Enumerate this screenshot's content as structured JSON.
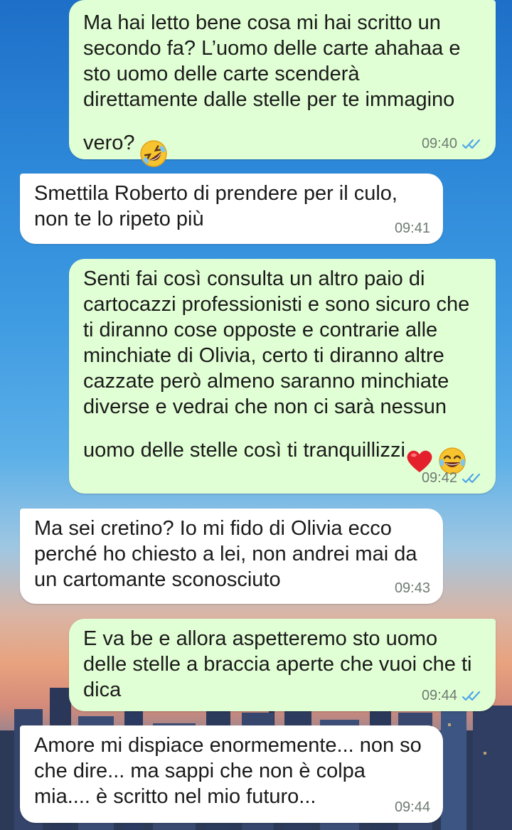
{
  "messages": [
    {
      "direction": "outgoing",
      "text": "Ma hai letto bene cosa mi hai scritto un secondo fa? L’uomo delle carte ahahaa e sto uomo delle carte scenderà direttamente dalle stelle per te immagino vero?",
      "emoji": [
        "rolling-on-floor-laughing"
      ],
      "time": "09:40",
      "status": "read"
    },
    {
      "direction": "incoming",
      "text": "Smettila Roberto di prendere per il culo, non te lo ripeto più",
      "time": "09:41"
    },
    {
      "direction": "outgoing",
      "text": "Senti fai così consulta un altro paio di cartocazzi professionisti e sono sicuro che ti diranno cose opposte e contrarie alle minchiate di Olivia, certo ti diranno altre cazzate però almeno saranno minchiate diverse e vedrai che non ci sarà nessun uomo delle stelle così ti tranquillizzi",
      "emoji": [
        "red-heart",
        "face-with-tears-of-joy"
      ],
      "time": "09:42",
      "status": "read"
    },
    {
      "direction": "incoming",
      "text": "Ma sei cretino? Io mi fido di Olivia ecco perché ho chiesto a lei, non andrei mai da un cartomante sconosciuto",
      "time": "09:43"
    },
    {
      "direction": "outgoing",
      "text": "E va be e allora aspetteremo sto uomo delle stelle a braccia aperte che vuoi che ti dica",
      "time": "09:44",
      "status": "read"
    },
    {
      "direction": "incoming",
      "text": "Amore mi dispiace enormemente... non so che dire... ma sappi che non è colpa mia.... è scritto nel mio futuro...",
      "time": "09:44"
    }
  ],
  "colors": {
    "outgoing_bubble": "#e1ffd4",
    "incoming_bubble": "#ffffff",
    "read_ticks": "#4fa6e8"
  }
}
